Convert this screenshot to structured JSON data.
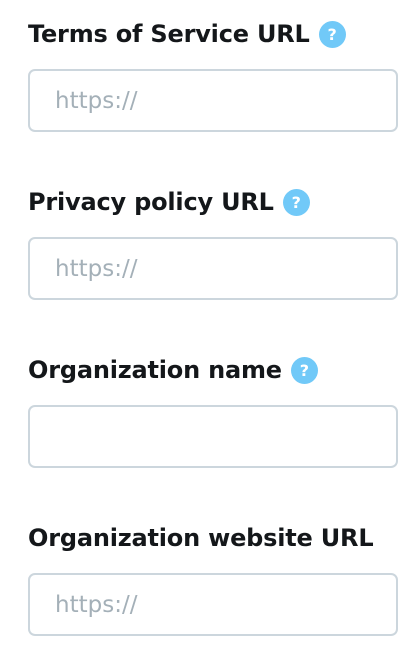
{
  "fields": [
    {
      "label": "Terms of Service URL",
      "has_help_icon": true,
      "help_icon": "question-mark-icon",
      "value": "",
      "placeholder": "https://"
    },
    {
      "label": "Privacy policy URL",
      "has_help_icon": true,
      "help_icon": "question-mark-icon",
      "value": "",
      "placeholder": "https://"
    },
    {
      "label": "Organization name",
      "has_help_icon": true,
      "help_icon": "question-mark-icon",
      "value": "",
      "placeholder": ""
    },
    {
      "label": "Organization website URL",
      "has_help_icon": false,
      "value": "",
      "placeholder": "https://"
    }
  ],
  "help_icon_glyph": "?",
  "colors": {
    "label_text": "#14171a",
    "help_icon_bg": "#71c9f8",
    "input_border": "#ccd6dd",
    "placeholder": "#a4b0b8"
  }
}
